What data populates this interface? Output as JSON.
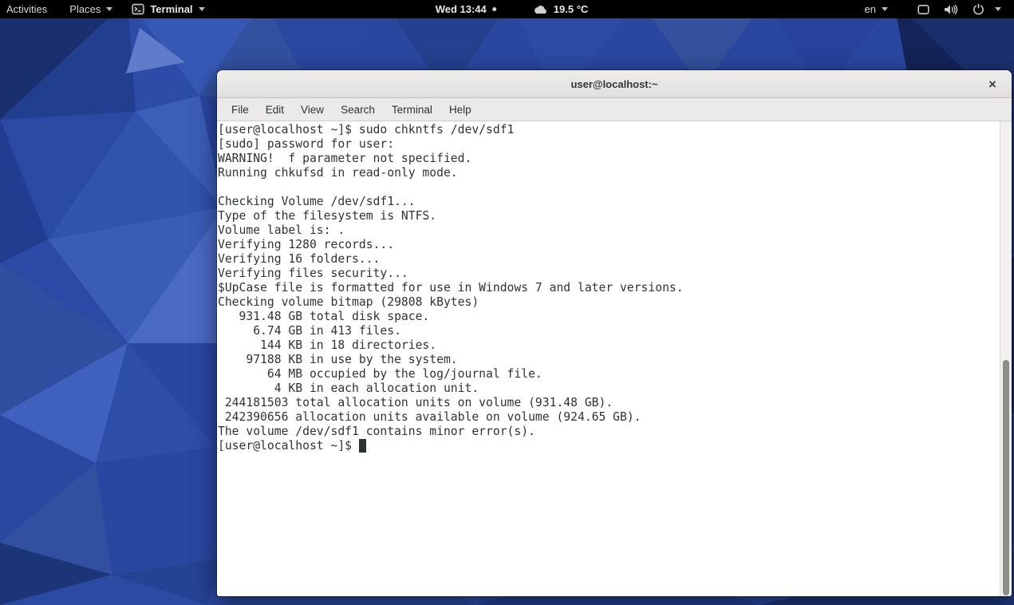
{
  "top_bar": {
    "activities_label": "Activities",
    "places_label": "Places",
    "app_menu_label": "Terminal",
    "clock_label": "Wed 13:44",
    "weather_label": "19.5 °C",
    "keyboard_layout_label": "en"
  },
  "icons": {
    "close": "×",
    "terminal_app": "terminal-prompt-glyph",
    "weather": "cloud",
    "system": [
      "display",
      "volume",
      "power",
      "dropdown"
    ]
  },
  "window": {
    "title": "user@localhost:~",
    "menu_items": [
      "File",
      "Edit",
      "View",
      "Search",
      "Terminal",
      "Help"
    ]
  },
  "terminal": {
    "output_lines": [
      "[user@localhost ~]$ sudo chkntfs /dev/sdf1",
      "[sudo] password for user:",
      "WARNING!  f parameter not specified.",
      "Running chkufsd in read-only mode.",
      "",
      "Checking Volume /dev/sdf1...",
      "Type of the filesystem is NTFS.",
      "Volume label is: .",
      "Verifying 1280 records...",
      "Verifying 16 folders...",
      "Verifying files security...",
      "$UpCase file is formatted for use in Windows 7 and later versions.",
      "Checking volume bitmap (29808 kBytes)",
      "   931.48 GB total disk space.",
      "     6.74 GB in 413 files.",
      "      144 KB in 18 directories.",
      "    97188 KB in use by the system.",
      "       64 MB occupied by the log/journal file.",
      "        4 KB in each allocation unit.",
      " 244181503 total allocation units on volume (931.48 GB).",
      " 242390656 allocation units available on volume (924.65 GB).",
      "The volume /dev/sdf1 contains minor error(s).",
      ""
    ],
    "prompt_line": "[user@localhost ~]$ "
  },
  "colors": {
    "top_bar_bg": "#000000",
    "wallpaper_base": "#2a47a0",
    "terminal_fg": "#2e3436",
    "terminal_bg": "#ffffff",
    "titlebar_bg": "#e9e7e5",
    "scrollbar_thumb": "#8c8c89"
  }
}
